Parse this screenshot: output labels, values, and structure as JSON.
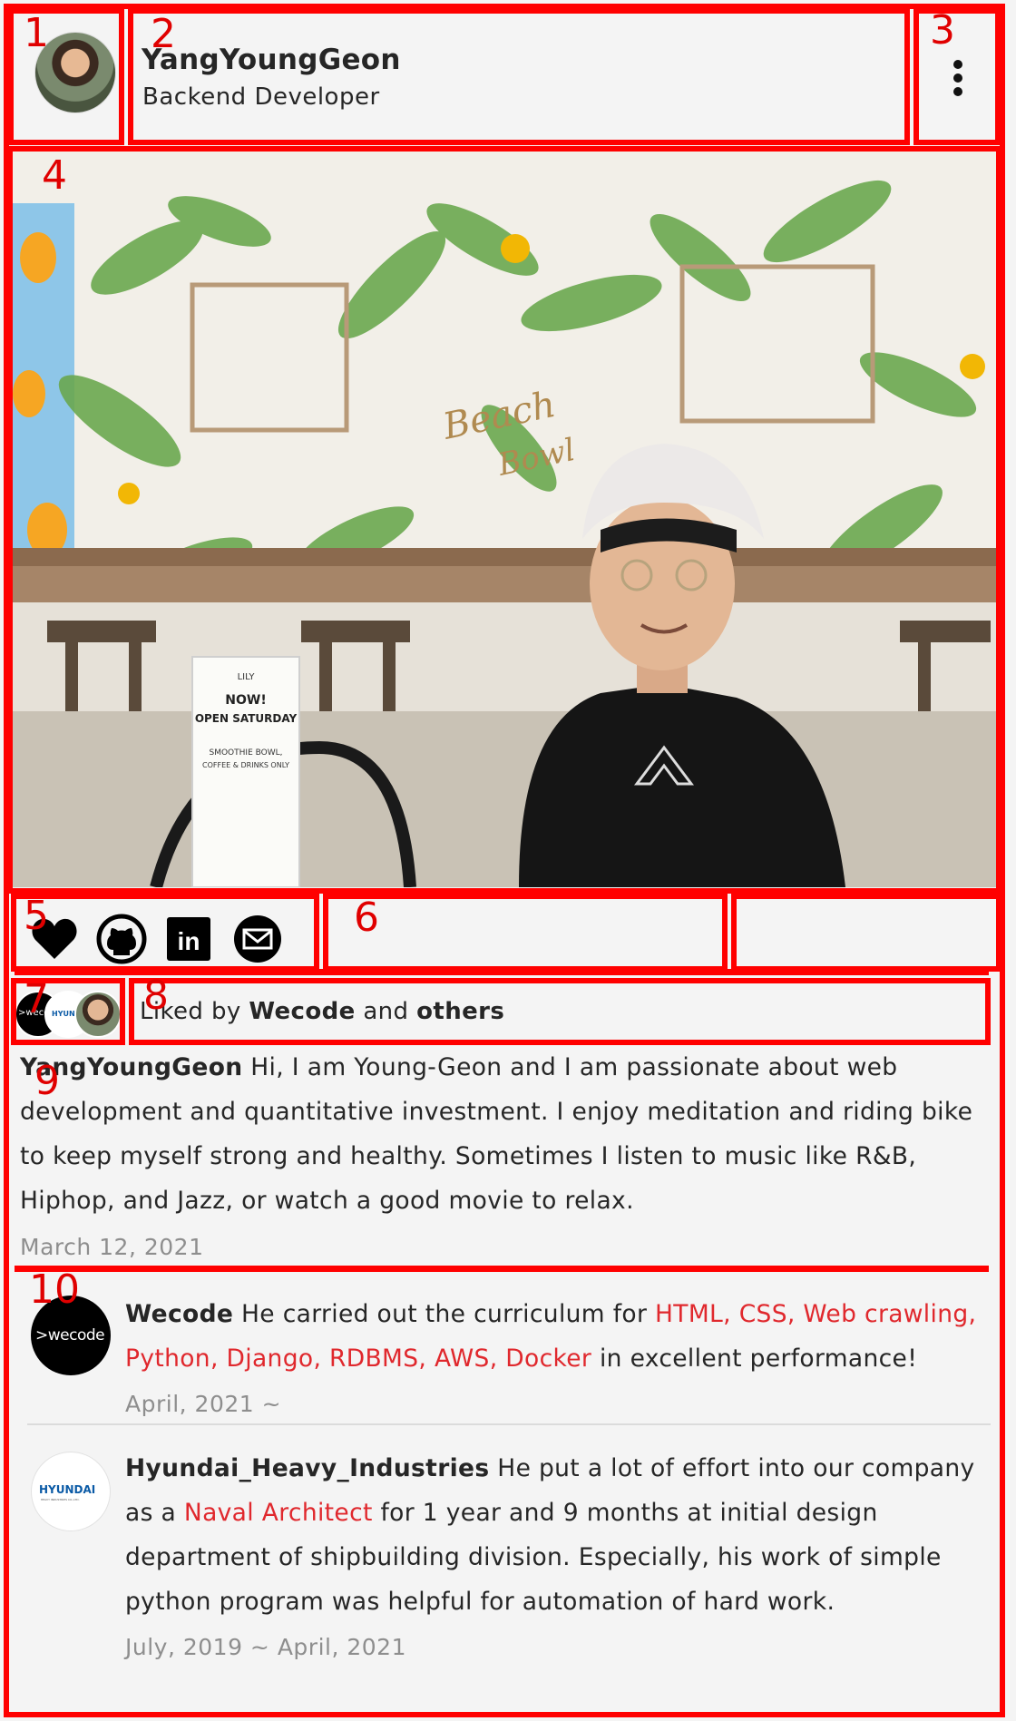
{
  "profile": {
    "name": "YangYoungGeon",
    "role": "Backend Developer"
  },
  "annotations": [
    "1",
    "2",
    "3",
    "4",
    "5",
    "6",
    "7",
    "8",
    "9",
    "10"
  ],
  "photo": {
    "sign_line1": "LILY",
    "sign_line2": "NOW!",
    "sign_line3": "OPEN SATURDAY",
    "sign_line4": "SMOOTHIE BOWL,",
    "sign_line5": "COFFEE & DRINKS ONLY",
    "mural_line1": "Beach",
    "mural_line2": "Bowl"
  },
  "actions": {
    "icons": [
      "heart-icon",
      "github-icon",
      "linkedin-icon",
      "mail-icon"
    ],
    "linkedin_text": "in"
  },
  "likes": {
    "prefix": "Liked by ",
    "user": "Wecode",
    "middle": " and ",
    "others": "others",
    "avatar1_text": ">wecode",
    "avatar2_text": "HYUNDAI"
  },
  "caption": {
    "author": "YangYoungGeon",
    "text": " Hi, I am Young-Geon and I am passionate about web development and quantitative investment. I enjoy meditation and riding bike to keep myself strong and healthy. Sometimes I listen to music like R&B, Hiphop, and Jazz, or watch a good movie to relax.",
    "date": "March 12, 2021"
  },
  "comments": [
    {
      "author": "Wecode",
      "logo_text": ">wecode",
      "text_before": " He carried out the curriculum for ",
      "highlight": "HTML, CSS, Web crawling, Python, Django, RDBMS, AWS, Docker",
      "text_after": " in excellent performance!",
      "date": "April, 2021 ~"
    },
    {
      "author": "Hyundai_Heavy_Industries",
      "logo_text": "HYUNDAI",
      "logo_subtext": "HEAVY INDUSTRIES CO.,LTD.",
      "text_before": " He put a lot of effort into our company as a ",
      "highlight": "Naval Architect",
      "text_after": " for 1 year and 9 months at initial design department of shipbuilding division. Especially, his work of simple python program was helpful for automation of hard work.",
      "date": "July, 2019 ~ April, 2021"
    }
  ],
  "colors": {
    "annotation": "#ff0000",
    "highlight": "#e0282d",
    "muted": "#8e8e8e",
    "background": "#f4f4f4"
  }
}
